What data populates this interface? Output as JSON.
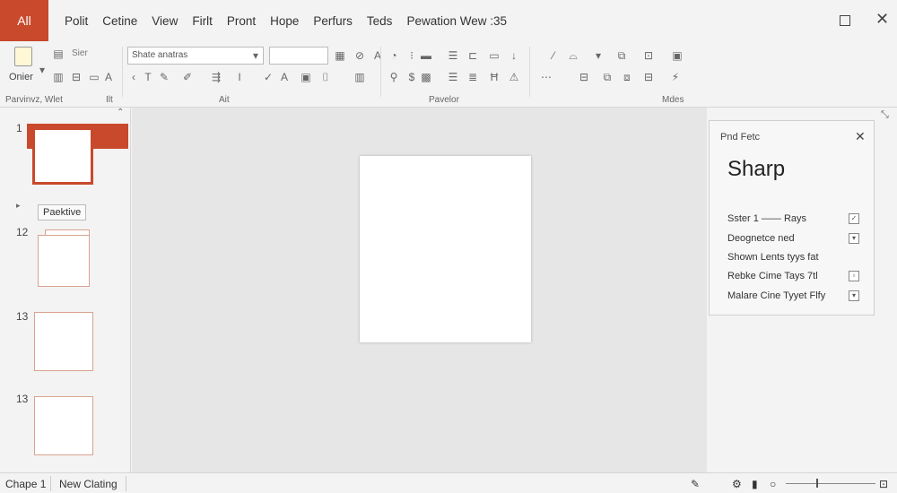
{
  "menubar": {
    "file_tab": "All",
    "items": [
      "Polit",
      "Cetine",
      "View",
      "Firlt",
      "Pront",
      "Hope",
      "Perfurs",
      "Teds",
      "Pewation Wew :35"
    ]
  },
  "ribbon": {
    "paste_label": "Onier",
    "new_label": "Sier",
    "font_box": "Shate anatras",
    "groups": [
      "Parvinvz, Wlet",
      "Ilt",
      "Ait",
      "Pavelor",
      "Mdes"
    ]
  },
  "thumbnails": {
    "items": [
      {
        "num": "1"
      },
      {
        "num": "12"
      },
      {
        "num": "13"
      },
      {
        "num": "13"
      }
    ],
    "tooltip": "Paektive"
  },
  "panel": {
    "title": "Pnd Fetc",
    "heading": "Sharp",
    "options": [
      {
        "label": "Sster 1 —— Rays",
        "checked": true
      },
      {
        "label": "Deognetce ned",
        "checked": true
      },
      {
        "label": "Shown Lents tyys fat",
        "checked": false
      },
      {
        "label": "Rebke Cime Tays 7tl",
        "checked": true
      },
      {
        "label": "Malare Cine Tyyet Flfy",
        "checked": true
      }
    ]
  },
  "statusbar": {
    "slide_label": "Chape 1",
    "notes_label": "New Clating"
  },
  "colors": {
    "accent": "#c8492b",
    "canvas": "#e6e6e6",
    "chrome": "#f3f3f3"
  }
}
